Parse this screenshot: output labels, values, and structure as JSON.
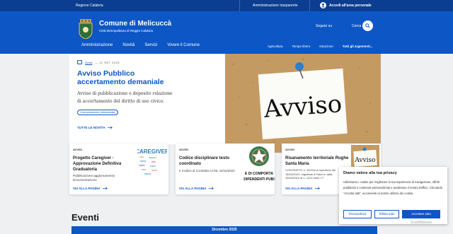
{
  "topbar": {
    "region": "Regione Calabria",
    "transparency": "Amministrazione trasparente",
    "login": "Accedi all'area personale"
  },
  "header": {
    "site_name": "Comune di Melicuccà",
    "site_sub": "Città Metropolitana di Reggio Calabria",
    "follow_label": "Seguici su",
    "search_label": "Cerca"
  },
  "nav": {
    "main": [
      "Amministrazione",
      "Novità",
      "Servizi",
      "Vivere il Comune"
    ],
    "topics": [
      "Agricoltura",
      "Tempo libero",
      "Istruzione",
      "Tutti gli argomenti..."
    ]
  },
  "hero": {
    "kicker": "Avvisi",
    "date": "— 11 SET 2025",
    "title": "Avviso Pubblico accertamento demaniale",
    "description": "Avviso di pubblicazione e deposito relazione di accertamento del diritto di uso civico.",
    "chip": "Comunicazione istituzionale",
    "all_news": "TUTTE LE NOVITÀ",
    "image_text": "Avviso"
  },
  "cards": [
    {
      "kicker": "AVVISI",
      "title": "Progetto Caregiver - Approvazione Definitiva Graduatoria",
      "desc": "Pubblicazione aggiornamento Documentazione",
      "more": "VAI ALLA PAGINA",
      "thumb_text": "CAREGIVER"
    },
    {
      "kicker": "AVVISI",
      "title": "Codice disciplinare testo coordinato",
      "desc": "e Codice di Condotta CCNL 16/11/2022",
      "more": "VAI ALLA PAGINA",
      "thumb_text": "E DI COMPORTA / DIPENDENTI PUBI"
    },
    {
      "kicker": "AVVISI",
      "title": "Risanamento territoriale Rughe Santa Maria",
      "desc": "CONTRATTO n. 3/2024 di repertorio del 16/04/2024, registrato a Palmi in data 16/04/2024 al n. 1222 serie 1T",
      "more": "VAI ALLA PAGINA",
      "thumb_text": "Avviso"
    }
  ],
  "events": {
    "title": "Eventi",
    "month": "Dicembre 2025"
  },
  "cookie": {
    "title": "Diamo valore alla tua privacy",
    "body": "Utilizziamo i cookie per migliorare la tua esperienza di navigazione, offrirti pubblicità o contenuti personalizzati e analizzare il nostro traffico. Cliccando \"Accetta tutti\", acconsenti al nostro utilizzo dei cookie.",
    "btn_customize": "Personalizza",
    "btn_reject": "Rifiuta tutto",
    "btn_accept": "Accettare tutto"
  },
  "watermark": "ScanMalware",
  "colors": {
    "primary": "#0d56c5",
    "topbar": "#0b3d91",
    "cork": "#c49a63"
  }
}
